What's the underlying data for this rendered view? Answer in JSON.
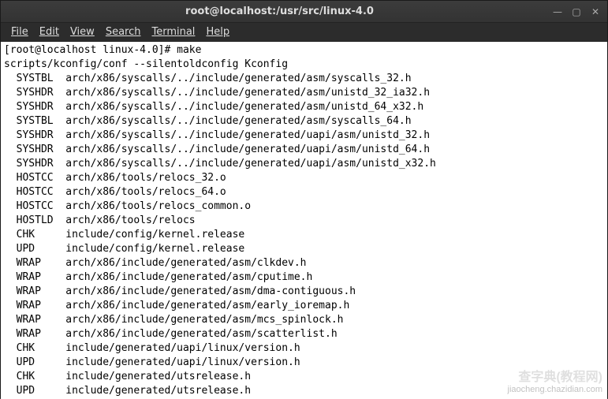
{
  "window": {
    "title": "root@localhost:/usr/src/linux-4.0"
  },
  "menubar": {
    "items": [
      "File",
      "Edit",
      "View",
      "Search",
      "Terminal",
      "Help"
    ]
  },
  "terminal": {
    "prompt": "[root@localhost linux-4.0]# ",
    "command": "make",
    "preline": "scripts/kconfig/conf --silentoldconfig Kconfig",
    "lines": [
      {
        "label": "SYSTBL",
        "path": "arch/x86/syscalls/../include/generated/asm/syscalls_32.h"
      },
      {
        "label": "SYSHDR",
        "path": "arch/x86/syscalls/../include/generated/asm/unistd_32_ia32.h"
      },
      {
        "label": "SYSHDR",
        "path": "arch/x86/syscalls/../include/generated/asm/unistd_64_x32.h"
      },
      {
        "label": "SYSTBL",
        "path": "arch/x86/syscalls/../include/generated/asm/syscalls_64.h"
      },
      {
        "label": "SYSHDR",
        "path": "arch/x86/syscalls/../include/generated/uapi/asm/unistd_32.h"
      },
      {
        "label": "SYSHDR",
        "path": "arch/x86/syscalls/../include/generated/uapi/asm/unistd_64.h"
      },
      {
        "label": "SYSHDR",
        "path": "arch/x86/syscalls/../include/generated/uapi/asm/unistd_x32.h"
      },
      {
        "label": "HOSTCC",
        "path": "arch/x86/tools/relocs_32.o"
      },
      {
        "label": "HOSTCC",
        "path": "arch/x86/tools/relocs_64.o"
      },
      {
        "label": "HOSTCC",
        "path": "arch/x86/tools/relocs_common.o"
      },
      {
        "label": "HOSTLD",
        "path": "arch/x86/tools/relocs"
      },
      {
        "label": "CHK",
        "path": "include/config/kernel.release"
      },
      {
        "label": "UPD",
        "path": "include/config/kernel.release"
      },
      {
        "label": "WRAP",
        "path": "arch/x86/include/generated/asm/clkdev.h"
      },
      {
        "label": "WRAP",
        "path": "arch/x86/include/generated/asm/cputime.h"
      },
      {
        "label": "WRAP",
        "path": "arch/x86/include/generated/asm/dma-contiguous.h"
      },
      {
        "label": "WRAP",
        "path": "arch/x86/include/generated/asm/early_ioremap.h"
      },
      {
        "label": "WRAP",
        "path": "arch/x86/include/generated/asm/mcs_spinlock.h"
      },
      {
        "label": "WRAP",
        "path": "arch/x86/include/generated/asm/scatterlist.h"
      },
      {
        "label": "CHK",
        "path": "include/generated/uapi/linux/version.h"
      },
      {
        "label": "UPD",
        "path": "include/generated/uapi/linux/version.h"
      },
      {
        "label": "CHK",
        "path": "include/generated/utsrelease.h"
      },
      {
        "label": "UPD",
        "path": "include/generated/utsrelease.h"
      }
    ]
  },
  "watermark": {
    "big": "查字典(教程网)",
    "small": "jiaocheng.chazidian.com"
  }
}
